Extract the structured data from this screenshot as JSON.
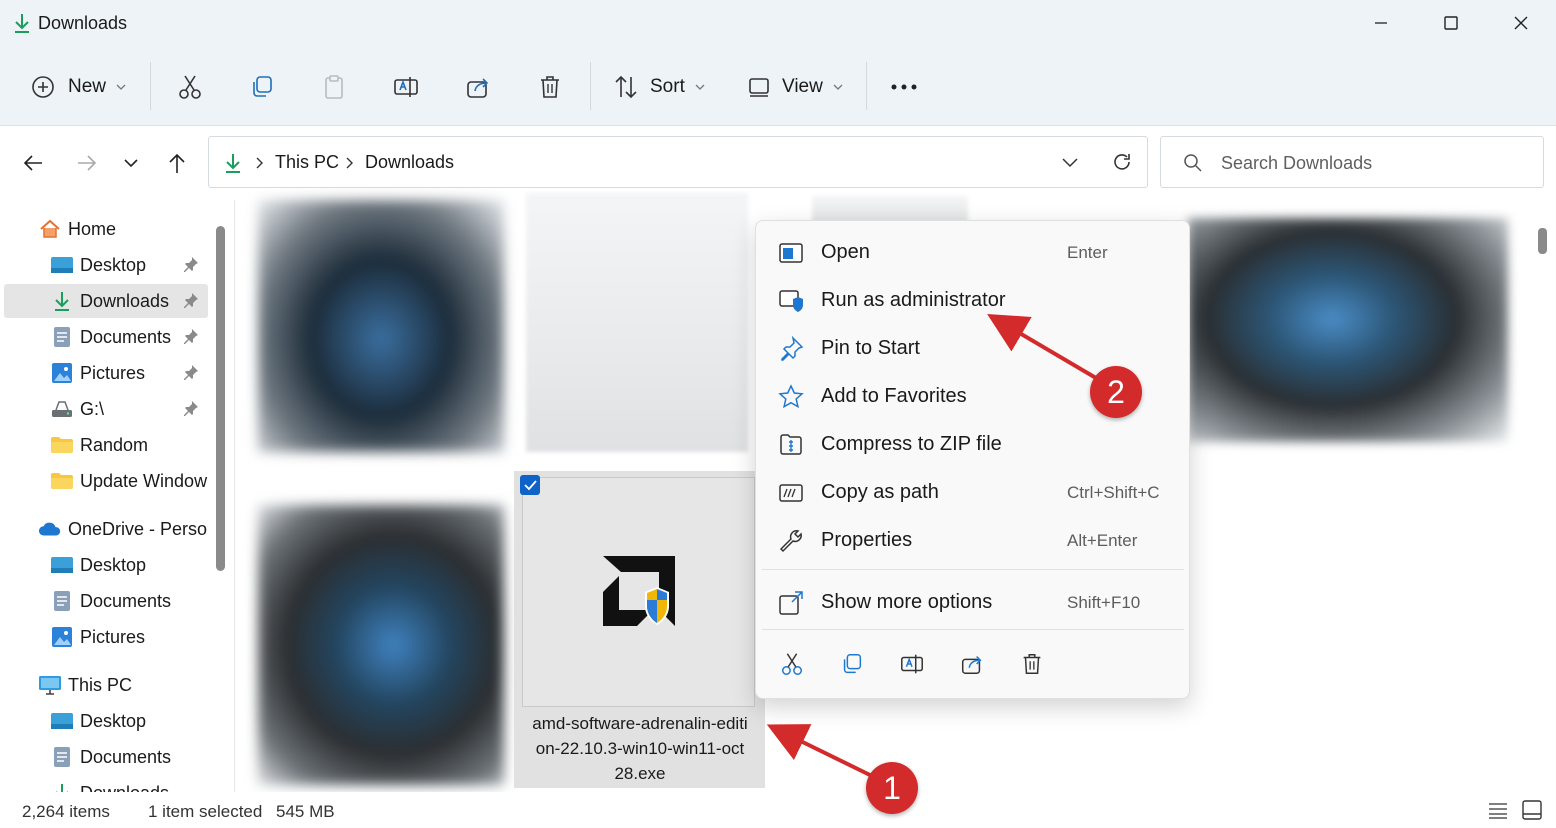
{
  "window": {
    "title": "Downloads"
  },
  "toolbar": {
    "new_label": "New",
    "sort_label": "Sort",
    "view_label": "View"
  },
  "address": {
    "crumbs": [
      "This PC",
      "Downloads"
    ]
  },
  "search": {
    "placeholder": "Search Downloads"
  },
  "sidebar": {
    "items": [
      {
        "label": "Home",
        "icon": "home-icon"
      },
      {
        "label": "Desktop",
        "icon": "desktop-folder-icon",
        "pinned": true
      },
      {
        "label": "Downloads",
        "icon": "download-icon",
        "pinned": true,
        "selected": true
      },
      {
        "label": "Documents",
        "icon": "documents-icon",
        "pinned": true
      },
      {
        "label": "Pictures",
        "icon": "pictures-icon",
        "pinned": true
      },
      {
        "label": "G:\\",
        "icon": "drive-icon",
        "pinned": true
      },
      {
        "label": "Random",
        "icon": "folder-icon"
      },
      {
        "label": "Update Window",
        "icon": "folder-icon"
      },
      {
        "label": "OneDrive - Persor",
        "icon": "onedrive-icon"
      },
      {
        "label": "Desktop",
        "icon": "desktop-folder-icon"
      },
      {
        "label": "Documents",
        "icon": "documents-icon"
      },
      {
        "label": "Pictures",
        "icon": "pictures-icon"
      },
      {
        "label": "This PC",
        "icon": "computer-icon"
      },
      {
        "label": "Desktop",
        "icon": "desktop-folder-icon"
      },
      {
        "label": "Documents",
        "icon": "documents-icon"
      },
      {
        "label": "Downloads",
        "icon": "download-icon"
      }
    ]
  },
  "files": {
    "selected_name": "amd-software-adrenalin-edition-22.10.3-win10-win11-oct28.exe",
    "selected_name_lines": [
      "amd-software-adrenalin-editi",
      "on-22.10.3-win10-win11-oct",
      "28.exe"
    ]
  },
  "context_menu": {
    "items": [
      {
        "label": "Open",
        "shortcut": "Enter",
        "icon": "open-icon"
      },
      {
        "label": "Run as administrator",
        "shortcut": "",
        "icon": "shield-icon"
      },
      {
        "label": "Pin to Start",
        "shortcut": "",
        "icon": "pin-icon"
      },
      {
        "label": "Add to Favorites",
        "shortcut": "",
        "icon": "star-icon"
      },
      {
        "label": "Compress to ZIP file",
        "shortcut": "",
        "icon": "zip-icon"
      },
      {
        "label": "Copy as path",
        "shortcut": "Ctrl+Shift+C",
        "icon": "copy-path-icon"
      },
      {
        "label": "Properties",
        "shortcut": "Alt+Enter",
        "icon": "wrench-icon"
      },
      {
        "label": "Show more options",
        "shortcut": "Shift+F10",
        "icon": "more-options-icon"
      }
    ],
    "quick_actions": [
      "cut-icon",
      "copy-icon",
      "rename-icon",
      "share-icon",
      "delete-icon"
    ]
  },
  "status": {
    "item_count": "2,264 items",
    "selection": "1 item selected",
    "size": "545 MB"
  },
  "annotations": {
    "step1": "1",
    "step2": "2",
    "color": "#d32b2b"
  }
}
